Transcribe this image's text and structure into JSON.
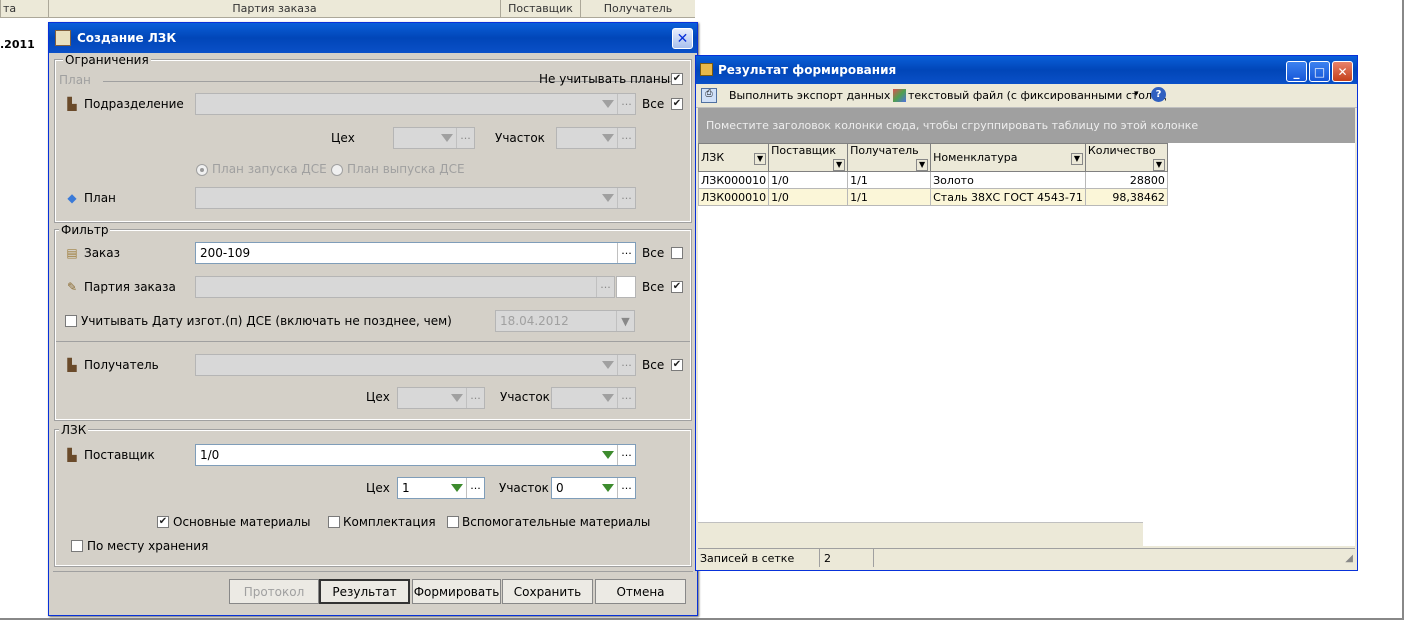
{
  "background": {
    "col_party": "Партия заказа",
    "col_supplier": "Поставщик",
    "col_receiver": "Получатель",
    "col_date_partial": "та",
    "date_partial": ".2011"
  },
  "dialog": {
    "title": "Создание ЛЗК",
    "restrictions_label": "Ограничения",
    "plan_group": "План",
    "ignore_plans_label": "Не учитывать планы",
    "ignore_plans_checked": true,
    "subdivision_label": "Подразделение",
    "all_label": "Все",
    "workshop_label": "Цех",
    "section_label": "Участок",
    "plan_launch_label": "План запуска ДСЕ",
    "plan_release_label": "План выпуска ДСЕ",
    "plan_label": "План",
    "filter_label": "Фильтр",
    "order_label": "Заказ",
    "order_value": "200-109",
    "order_batch_label": "Партия заказа",
    "date_check_label": "Учитывать Дату изгот.(п) ДСЕ (включать не позднее, чем)",
    "date_value": "18.04.2012",
    "receiver_label": "Получатель",
    "lzk_label": "ЛЗК",
    "supplier_label": "Поставщик",
    "supplier_value": "1/0",
    "supplier_workshop_value": "1",
    "supplier_section_value": "0",
    "main_materials_label": "Основные материалы",
    "complect_label": "Комплектация",
    "aux_materials_label": "Вспомогательные материалы",
    "storage_label": "По месту хранения",
    "buttons": {
      "protocol": "Протокол",
      "result": "Результат",
      "form": "Формировать",
      "save": "Сохранить",
      "cancel": "Отмена"
    }
  },
  "result": {
    "title": "Результат формирования",
    "export_label": "Выполнить экспорт данных в:",
    "export_target": "текстовый файл (с фиксированными столбц",
    "group_hint": "Поместите заголовок колонки сюда, чтобы сгруппировать таблицу по этой колонке",
    "columns": [
      "ЛЗК",
      "Поставщик",
      "Получатель",
      "Номенклатура",
      "Количество"
    ],
    "rows": [
      [
        "ЛЗК000010",
        "1/0",
        "1/1",
        "Золото",
        "28800"
      ],
      [
        "ЛЗК000010",
        "1/0",
        "1/1",
        "Сталь 38ХС ГОСТ 4543-71",
        "98,38462"
      ]
    ],
    "status_label": "Записей в сетке",
    "status_count": "2"
  }
}
